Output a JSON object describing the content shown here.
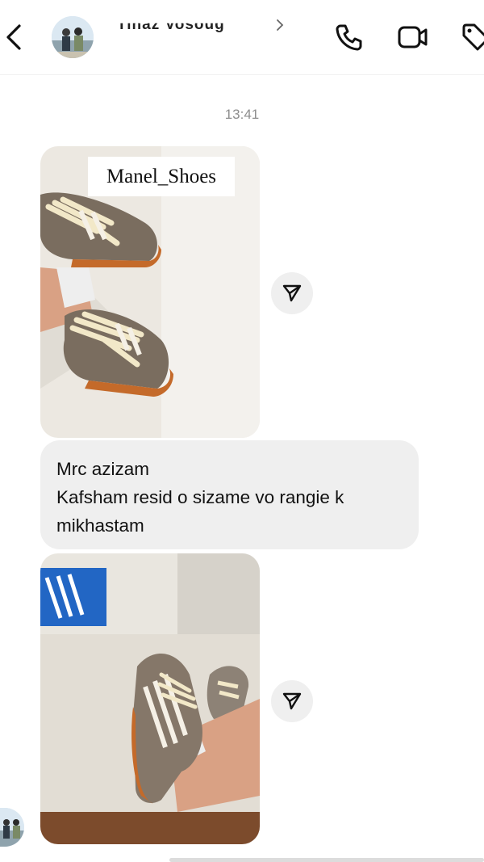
{
  "header": {
    "contact_name": "Tinaz Vosoug",
    "icons": [
      "back-arrow-icon",
      "phone-icon",
      "video-camera-icon",
      "tag-icon"
    ]
  },
  "chat": {
    "timestamp": "13:41",
    "shared_post_1": {
      "watermark": "Manel_Shoes"
    },
    "message": {
      "line1": "Mrc azizam",
      "line2": "Kafsham resid o sizame vo rangie k",
      "line3": "mikhastam"
    }
  },
  "colors": {
    "bubble_bg": "#efefef",
    "text_primary": "#111111",
    "text_muted": "#8e8e8e"
  }
}
